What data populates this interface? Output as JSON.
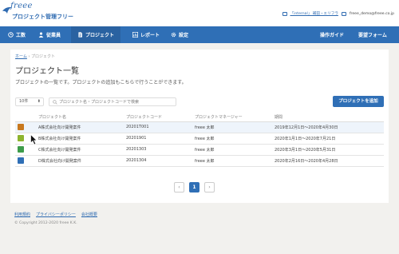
{
  "header": {
    "logo_script": "freee",
    "logo_sub": "プロジェクト管理フリー",
    "company_link": "「internal」 補田・エリフラ",
    "user_email": "freee_demo@freee.co.jp"
  },
  "nav": {
    "items": [
      {
        "label": "工数",
        "icon": "clock-icon"
      },
      {
        "label": "従業員",
        "icon": "person-icon"
      },
      {
        "label": "プロジェクト",
        "icon": "document-icon"
      },
      {
        "label": "レポート",
        "icon": "chart-icon"
      },
      {
        "label": "設定",
        "icon": "gear-icon"
      }
    ],
    "right": [
      "操作ガイド",
      "要望フォーム"
    ],
    "colors": {
      "nav_bg": "#2f6fb6",
      "active_bg": "#2a62a1"
    }
  },
  "breadcrumb": {
    "home": "ホーム",
    "separator": "›",
    "current": "プロジェクト"
  },
  "page": {
    "title": "プロジェクト一覧",
    "description": "プロジェクトの一覧です。プロジェクトの追加もこちらで行うことができます。"
  },
  "filter": {
    "selected": "10件",
    "arrow": "⬍"
  },
  "search": {
    "placeholder": "プロジェクト名・プロジェクトコードで検索"
  },
  "add_button": "プロジェクトを追加",
  "table": {
    "headers": [
      "",
      "プロジェクト名",
      "プロジェクトコード",
      "プロジェクトマネージャー",
      "期間"
    ],
    "rows": [
      {
        "color": "#c8781e",
        "name": "A株式会社向け開発案件",
        "code": "20201T001",
        "manager": "freee 太郎",
        "period": "2019年12月1日〜2020年4月30日"
      },
      {
        "color": "#8db42e",
        "name": "B株式会社向け開発案件",
        "code": "20201901",
        "manager": "freee 太郎",
        "period": "2020年1月1日〜2020年7月21日"
      },
      {
        "color": "#3d9c4a",
        "name": "C株式会社向け開発案件",
        "code": "20201303",
        "manager": "freee 太郎",
        "period": "2020年3月1日〜2020年5月31日"
      },
      {
        "color": "#2f6fb6",
        "name": "D株式会社向け開発案件",
        "code": "20201304",
        "manager": "freee 太郎",
        "period": "2020年2月16日〜2020年4月28日"
      }
    ]
  },
  "pagination": {
    "prev": "‹",
    "current": "1",
    "next": "›"
  },
  "footer": {
    "links": [
      "利用規約",
      "プライバシーポリシー",
      "会社概要"
    ],
    "copyright": "© Copyright 2012-2020 freee K.K."
  }
}
